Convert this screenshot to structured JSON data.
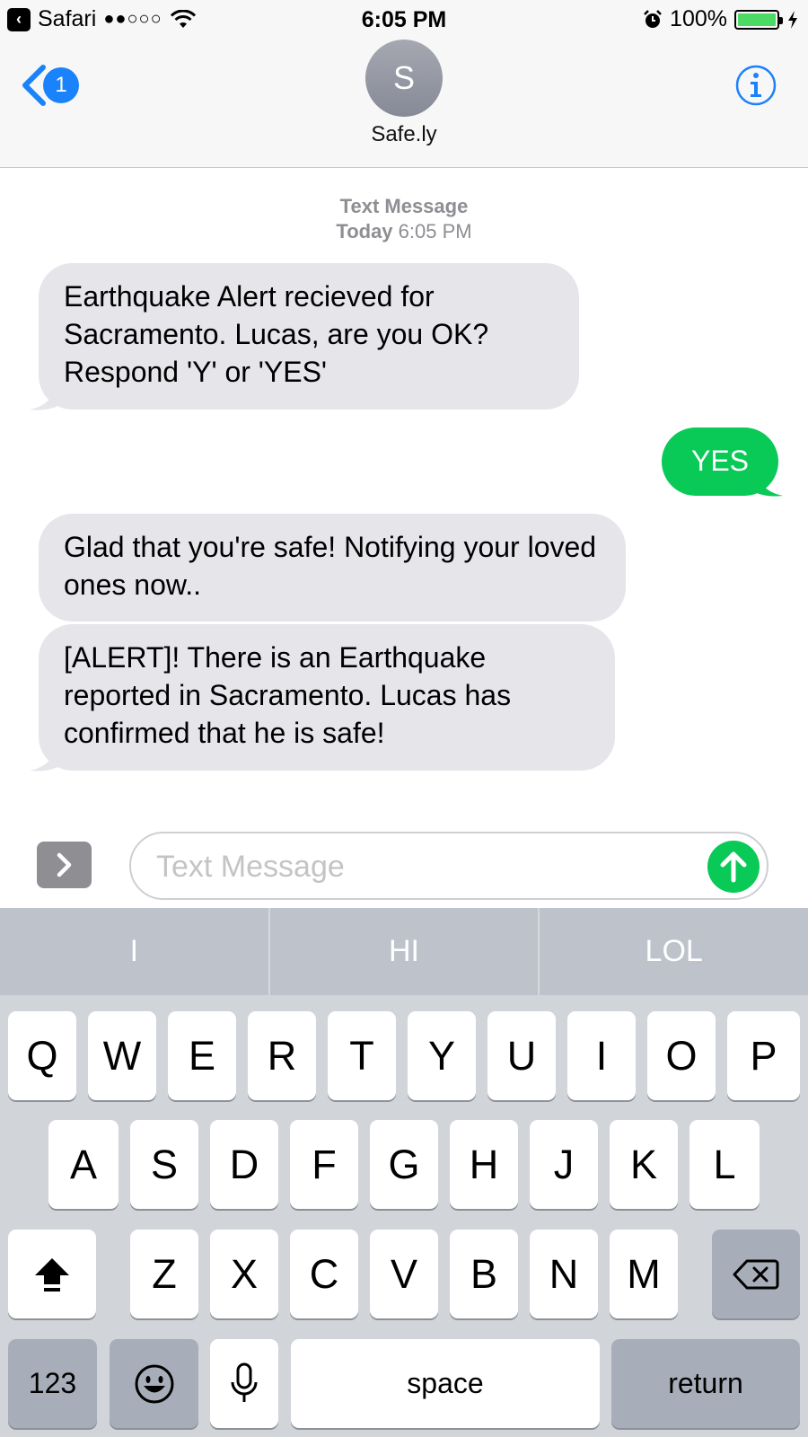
{
  "status_bar": {
    "app": "Safari",
    "signal": "●●○○○",
    "time": "6:05 PM",
    "battery": "100%"
  },
  "header": {
    "back_badge": "1",
    "avatar_initial": "S",
    "contact_name": "Safe.ly"
  },
  "conversation": {
    "meta_service": "Text Message",
    "meta_day": "Today",
    "meta_time": "6:05 PM",
    "messages": [
      {
        "direction": "received",
        "text": "Earthquake Alert recieved for Sacramento. Lucas, are you OK? Respond 'Y' or 'YES'"
      },
      {
        "direction": "sent",
        "text": "YES"
      },
      {
        "direction": "received",
        "text": "Glad that you're safe! Notifying your loved ones now.."
      },
      {
        "direction": "received",
        "text": "[ALERT]! There is an Earthquake reported in Sacramento. Lucas has confirmed that he is safe!"
      }
    ]
  },
  "composer": {
    "placeholder": "Text Message"
  },
  "keyboard": {
    "suggestions": [
      "I",
      "HI",
      "LOL"
    ],
    "row1": [
      "Q",
      "W",
      "E",
      "R",
      "T",
      "Y",
      "U",
      "I",
      "O",
      "P"
    ],
    "row2": [
      "A",
      "S",
      "D",
      "F",
      "G",
      "H",
      "J",
      "K",
      "L"
    ],
    "row3": [
      "Z",
      "X",
      "C",
      "V",
      "B",
      "N",
      "M"
    ],
    "numbers_label": "123",
    "space_label": "space",
    "return_label": "return"
  },
  "colors": {
    "accent": "#1a82fb",
    "sent_bubble": "#09c957",
    "received_bubble": "#e5e5ea"
  }
}
